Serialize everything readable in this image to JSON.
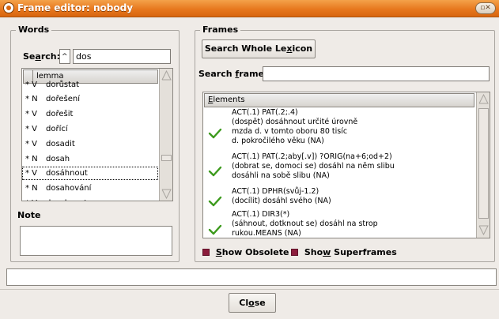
{
  "window": {
    "title": "Frame editor: nobody",
    "controls_glyph": "▫✕"
  },
  "words": {
    "legend": "Words",
    "search_label_pre": "Se",
    "search_label_u": "a",
    "search_label_post": "rch:",
    "search_prefix_value": "^",
    "search_value": "dos",
    "list_header": "lemma",
    "items": [
      {
        "pos": "* V",
        "lemma": "dorůstat"
      },
      {
        "pos": "* N",
        "lemma": "dořešení"
      },
      {
        "pos": "* V",
        "lemma": "dořešit"
      },
      {
        "pos": "* V",
        "lemma": "dořící"
      },
      {
        "pos": "* V",
        "lemma": "dosadit"
      },
      {
        "pos": "* N",
        "lemma": "dosah"
      },
      {
        "pos": "* V",
        "lemma": "dosáhnout",
        "selected": true
      },
      {
        "pos": "* N",
        "lemma": "dosahování"
      },
      {
        "pos": "* V",
        "lemma": "dosahovat"
      }
    ],
    "note_label": "Note",
    "note_value": ""
  },
  "frames": {
    "legend": "Frames",
    "search_whole_lexicon_pre": "Search Whole Le",
    "search_whole_lexicon_u": "x",
    "search_whole_lexicon_post": "icon",
    "search_frame_label_pre": "Search ",
    "search_frame_label_u": "f",
    "search_frame_label_post": "rame:",
    "search_frame_value": "",
    "elements_header_u": "E",
    "elements_header_rest": "lements",
    "entries": [
      {
        "lines": [
          "ACT(.1)  PAT(.2;.4)",
          "(dospět) dosáhnout určité úrovně",
          "mzda d. v tomto oboru 80 tisíc",
          "d. pokročilého věku (NA)"
        ]
      },
      {
        "lines": [
          "ACT(.1)  PAT(.2;aby[.v])     ?ORIG(na+6;od+2)",
          "(dobrat se, domoci se) dosáhl na něm slibu",
          "dosáhli na sobě slibu (NA)"
        ]
      },
      {
        "lines": [
          "ACT(.1)  DPHR(svůj-1.2)",
          "(docílit) dosáhl svého (NA)"
        ]
      },
      {
        "lines": [
          "ACT(.1)  DIR3(*)",
          "(sáhnout, dotknout se) dosáhl  na strop",
          "rukou.MEANS (NA)"
        ]
      }
    ],
    "show_obsolete_u": "S",
    "show_obsolete_rest": "how Obsolete",
    "show_superframes_pre": "Sho",
    "show_superframes_u": "w",
    "show_superframes_post": " Superframes",
    "check_color": "#8c1d3c",
    "accent_check_color": "#3c9a1c"
  },
  "status_text": "",
  "close_button_pre": "Cl",
  "close_button_u": "o",
  "close_button_post": "se"
}
